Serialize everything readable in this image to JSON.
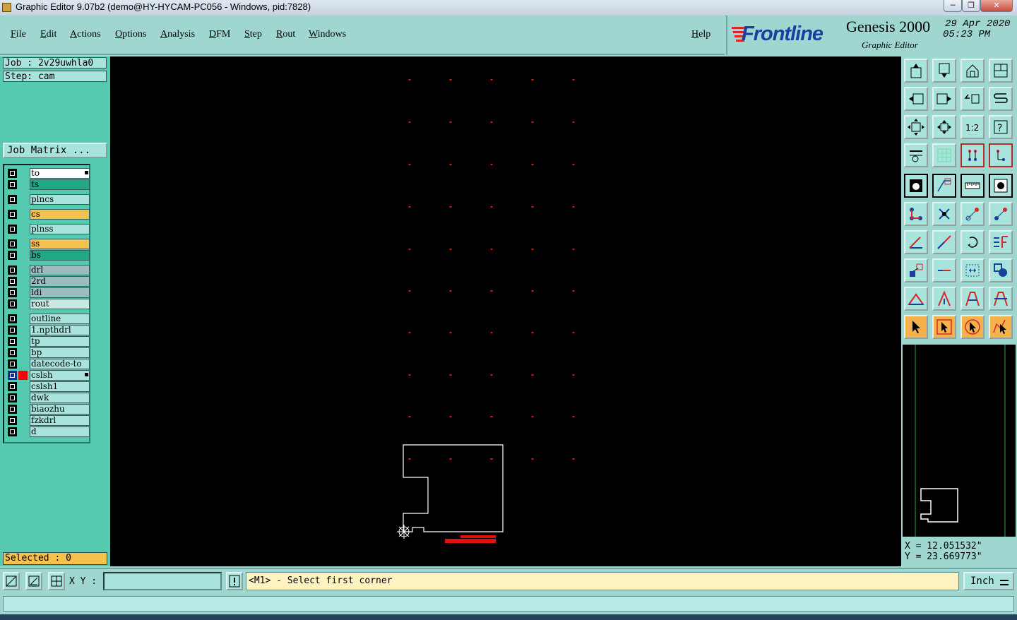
{
  "window": {
    "title": "Graphic Editor 9.07b2 (demo@HY-HYCAM-PC056 - Windows, pid:7828)",
    "controls": [
      "─",
      "❐",
      "✕"
    ]
  },
  "menu": {
    "items": [
      "File",
      "Edit",
      "Actions",
      "Options",
      "Analysis",
      "DFM",
      "Step",
      "Rout",
      "Windows"
    ],
    "help": "Help"
  },
  "brand": {
    "logo": "Frontline",
    "product": "Genesis 2000",
    "subtitle": "Graphic Editor",
    "date": "29 Apr 2020",
    "time": "05:23 PM"
  },
  "job": {
    "job_label": "Job : 2v29uwhla0",
    "step_label": "Step: cam",
    "matrix_button": "Job Matrix ..."
  },
  "layers": [
    {
      "name": "to",
      "color": "#ffffff",
      "marker": "pencil"
    },
    {
      "name": "ts",
      "color": "#1ea884"
    },
    {
      "name": "plncs",
      "color": "#a9e4dc"
    },
    {
      "name": "cs",
      "color": "#f6c14f"
    },
    {
      "name": "plnss",
      "color": "#a9e4dc"
    },
    {
      "name": "ss",
      "color": "#f6c14f"
    },
    {
      "name": "bs",
      "color": "#1ea884"
    },
    {
      "name": "drl",
      "color": "#9bbcc0"
    },
    {
      "name": "2rd",
      "color": "#9bbcc0"
    },
    {
      "name": "ldi",
      "color": "#9bbcc0"
    },
    {
      "name": "rout",
      "color": "#c9e8e4"
    },
    {
      "name": "outline",
      "color": "#a9e4dc"
    },
    {
      "name": "1.npthdrl",
      "color": "#a9e4dc"
    },
    {
      "name": "tp",
      "color": "#a9e4dc"
    },
    {
      "name": "bp",
      "color": "#a9e4dc"
    },
    {
      "name": "datecode-to",
      "color": "#a9e4dc"
    },
    {
      "name": "cslsh",
      "color": "#a9e4dc",
      "active": true,
      "marker": "work"
    },
    {
      "name": "cslsh1",
      "color": "#a9e4dc"
    },
    {
      "name": "dwk",
      "color": "#a9e4dc"
    },
    {
      "name": "biaozhu",
      "color": "#a9e4dc"
    },
    {
      "name": "fzkdrl",
      "color": "#a9e4dc"
    },
    {
      "name": "d",
      "color": "#a9e4dc"
    }
  ],
  "selection": {
    "label": "Selected : 0"
  },
  "coordinates": {
    "x": "X = 12.051532\"",
    "y": "Y = 23.669773\""
  },
  "prompt": {
    "xy_label": "X Y :",
    "xy_value": "",
    "message": "<M1> - Select first corner",
    "unit": "Inch"
  },
  "toolbar_icons": [
    "move-up-icon",
    "move-down-icon",
    "home-icon",
    "panel-split-icon",
    "move-left-icon",
    "move-right-icon",
    "undo-icon",
    "snake-icon",
    "fit-screen-icon",
    "zoom-center-icon",
    "scale-1-2-icon",
    "help-icon",
    "measure-icon",
    "grid-icon",
    "snap-icon",
    "snap-alt-icon",
    "pad-icon",
    "shape-icon",
    "ruler-icon",
    "circle-icon",
    "nodes-icon",
    "intersect-icon",
    "line-point-icon",
    "line-point-alt-icon",
    "angle-icon",
    "slash-icon",
    "arc-icon",
    "split-icon",
    "transform-icon",
    "minus-icon",
    "dimension-icon",
    "shapes-icon",
    "triangle-icon",
    "triangle-up-icon",
    "arch-icon",
    "arch-alt-icon",
    "select-icon",
    "select-box-icon",
    "select-circle-icon",
    "select-path-icon"
  ],
  "colors": {
    "canvas": "#000000",
    "panel": "#9fd7d0",
    "layer_panel": "#56c9b1",
    "pad": "#ff0000",
    "outline": "#ffffff"
  }
}
